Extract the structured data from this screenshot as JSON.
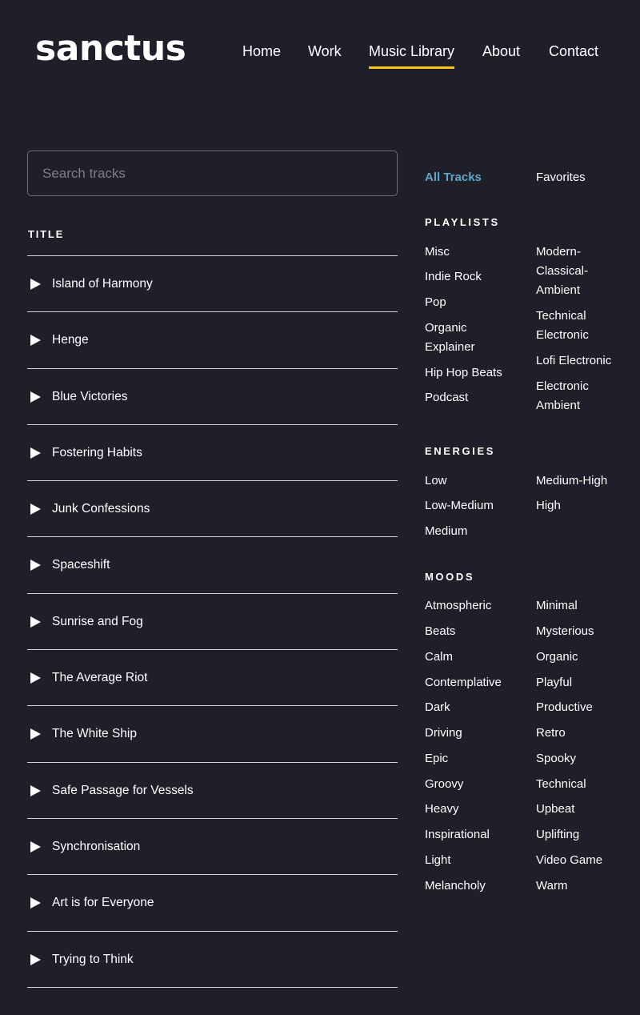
{
  "header": {
    "logo": "sanctus",
    "nav": [
      "Home",
      "Work",
      "Music Library",
      "About",
      "Contact"
    ],
    "active_nav": "Music Library",
    "accent_color": "#f5c518"
  },
  "search": {
    "placeholder": "Search tracks",
    "value": ""
  },
  "track_list": {
    "header": "TITLE",
    "tracks": [
      "Island of Harmony",
      "Henge",
      "Blue Victories",
      "Fostering Habits",
      "Junk Confessions",
      "Spaceshift",
      "Sunrise and Fog",
      "The Average Riot",
      "The White Ship",
      "Safe Passage for Vessels",
      "Synchronisation",
      "Art is for Everyone",
      "Trying to Think"
    ]
  },
  "sidebar": {
    "all_tracks": "All Tracks",
    "favorites": "Favorites",
    "active_color": "#5fa5c8",
    "playlists": {
      "heading": "PLAYLISTS",
      "col_a": [
        "Misc",
        "Indie Rock",
        "Pop",
        "Organic Explainer",
        "Hip Hop Beats",
        "Podcast"
      ],
      "col_b": [
        "Modern-Classical-Ambient",
        "Technical Electronic",
        "Lofi Electronic",
        "Electronic Ambient"
      ]
    },
    "energies": {
      "heading": "ENERGIES",
      "col_a": [
        "Low",
        "Low-Medium",
        "Medium"
      ],
      "col_b": [
        "Medium-High",
        "High"
      ]
    },
    "moods": {
      "heading": "MOODS",
      "col_a": [
        "Atmospheric",
        "Beats",
        "Calm",
        "Contemplative",
        "Dark",
        "Driving",
        "Epic",
        "Groovy",
        "Heavy",
        "Inspirational",
        "Light",
        "Melancholy"
      ],
      "col_b": [
        "Minimal",
        "Mysterious",
        "Organic",
        "Playful",
        "Productive",
        "Retro",
        "Spooky",
        "Technical",
        "Upbeat",
        "Uplifting",
        "Video Game",
        "Warm"
      ]
    }
  }
}
